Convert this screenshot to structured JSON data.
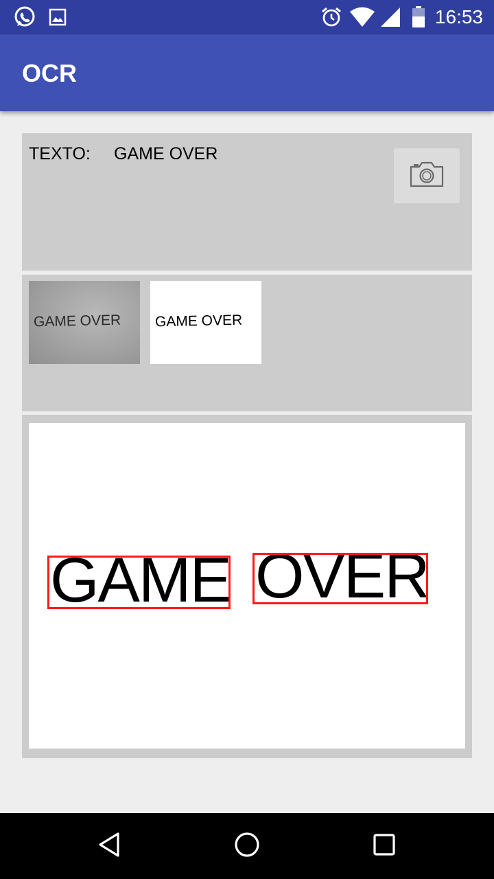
{
  "status_bar": {
    "time": "16:53",
    "icons": [
      "whatsapp-icon",
      "gallery-icon",
      "alarm-icon",
      "wifi-icon",
      "signal-icon",
      "battery-icon"
    ]
  },
  "app_bar": {
    "title": "OCR"
  },
  "text_panel": {
    "label": "TEXTO:",
    "value": "GAME OVER",
    "camera_button_icon": "camera-icon"
  },
  "thumbnails": {
    "original_text": "GAME OVER",
    "processed_text": "GAME OVER"
  },
  "result": {
    "words": [
      "GAME",
      "OVER"
    ],
    "box_color": "#ff1a1a"
  },
  "nav_bar": {
    "icons": [
      "back-icon",
      "home-icon",
      "recents-icon"
    ]
  },
  "colors": {
    "status_bar": "#303f9f",
    "app_bar": "#3f51b5",
    "panel": "#cccccc",
    "background": "#eeeeee"
  }
}
